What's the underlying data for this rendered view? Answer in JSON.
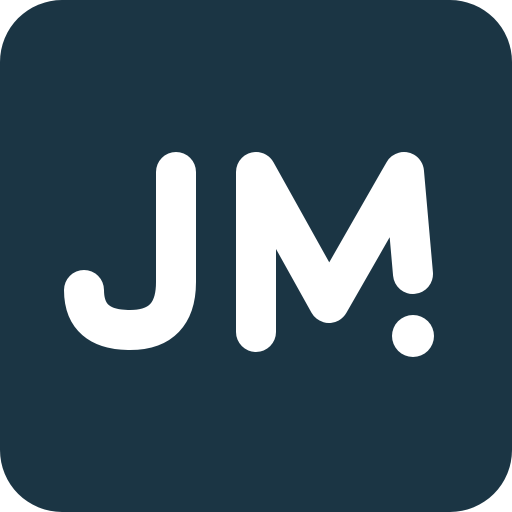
{
  "logo": {
    "text": "JM!",
    "background_color": "#1b3544",
    "foreground_color": "#ffffff"
  }
}
